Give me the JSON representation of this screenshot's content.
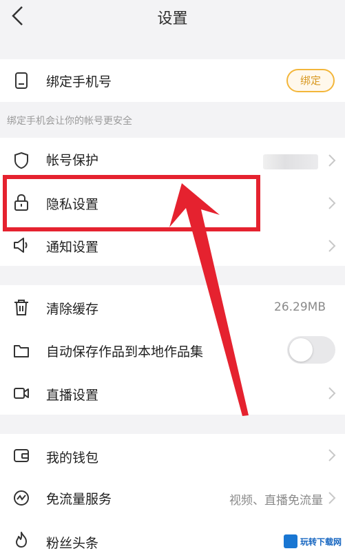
{
  "header": {
    "title": "设置",
    "back_icon": "chevron-left-icon"
  },
  "phone": {
    "label": "绑定手机号",
    "button": "绑定",
    "note": "绑定手机会让你的帐号更安全",
    "icon": "phone-icon"
  },
  "section1": [
    {
      "label": "帐号保护",
      "icon": "shield-icon"
    },
    {
      "label": "隐私设置",
      "icon": "lock-icon"
    },
    {
      "label": "通知设置",
      "icon": "speaker-icon"
    }
  ],
  "section2": {
    "cache": {
      "label": "清除缓存",
      "value": "26.29MB",
      "icon": "trash-icon"
    },
    "autosave": {
      "label": "自动保存作品到本地作品集",
      "icon": "folder-icon",
      "on": false
    },
    "live": {
      "label": "直播设置",
      "icon": "video-camera-icon"
    }
  },
  "section3": {
    "wallet": {
      "label": "我的钱包",
      "icon": "wallet-icon"
    },
    "data": {
      "label": "免流量服务",
      "value": "视频、直播免流量",
      "icon": "wave-icon"
    },
    "fans": {
      "label": "粉丝头条",
      "icon": "flame-icon"
    }
  },
  "watermark": {
    "text": "玩转下载网"
  },
  "colors": {
    "accent": "#f3b63a",
    "highlight": "#e5222f",
    "arrow": "#e5222f"
  }
}
